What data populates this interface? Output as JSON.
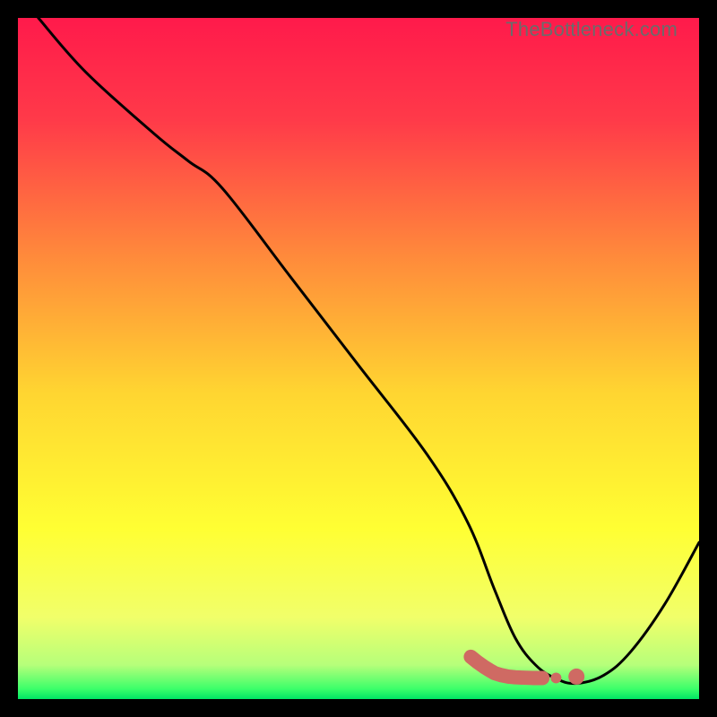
{
  "watermark": "TheBottleneck.com",
  "chart_data": {
    "type": "line",
    "title": "",
    "xlabel": "",
    "ylabel": "",
    "xlim": [
      0,
      100
    ],
    "ylim": [
      0,
      100
    ],
    "grid": false,
    "legend": false,
    "gradient_stops": [
      {
        "offset": 0.0,
        "color": "#ff1a4b"
      },
      {
        "offset": 0.15,
        "color": "#ff3a49"
      },
      {
        "offset": 0.35,
        "color": "#ff8a3b"
      },
      {
        "offset": 0.55,
        "color": "#ffd531"
      },
      {
        "offset": 0.75,
        "color": "#ffff33"
      },
      {
        "offset": 0.88,
        "color": "#f1ff6a"
      },
      {
        "offset": 0.95,
        "color": "#b6ff7a"
      },
      {
        "offset": 0.985,
        "color": "#3cff6a"
      },
      {
        "offset": 1.0,
        "color": "#00e565"
      }
    ],
    "series": [
      {
        "name": "bottleneck-curve",
        "type": "line",
        "color": "#000000",
        "x": [
          3,
          10,
          20,
          25,
          30,
          40,
          50,
          60,
          66,
          70,
          73,
          76,
          79,
          82,
          86,
          90,
          95,
          100
        ],
        "y": [
          100,
          92,
          83,
          79,
          75,
          62,
          49,
          36,
          26,
          16,
          9,
          5,
          3,
          2.3,
          3.5,
          7,
          14,
          23
        ]
      },
      {
        "name": "marker-cluster-left",
        "type": "scatter",
        "color": "#cf6a63",
        "marker": "thick-round",
        "x": [
          66.5,
          67.5,
          68.5,
          69.3,
          70.0,
          71.0,
          72.0,
          73.0,
          74.0,
          75.5,
          77.0
        ],
        "y": [
          6.2,
          5.4,
          4.7,
          4.2,
          3.8,
          3.5,
          3.3,
          3.2,
          3.15,
          3.1,
          3.1
        ]
      },
      {
        "name": "marker-gap-dot",
        "type": "scatter",
        "color": "#cf6a63",
        "marker": "dot",
        "x": [
          79.0
        ],
        "y": [
          3.1
        ]
      },
      {
        "name": "marker-cluster-right",
        "type": "scatter",
        "color": "#cf6a63",
        "marker": "dot-large",
        "x": [
          82.0
        ],
        "y": [
          3.3
        ]
      }
    ]
  }
}
